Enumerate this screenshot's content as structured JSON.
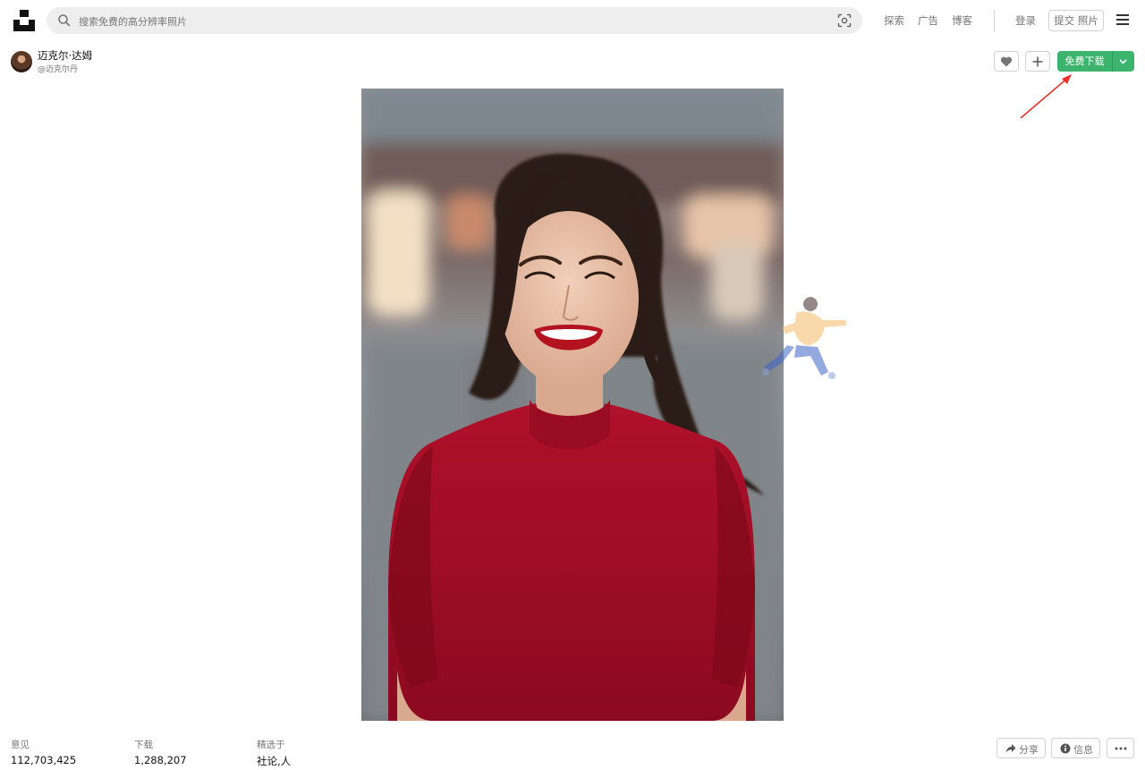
{
  "header": {
    "search_placeholder": "搜索免费的高分辨率照片",
    "nav": [
      "探索",
      "广告",
      "博客"
    ],
    "login": "登录",
    "submit_photo": "提交 照片"
  },
  "author": {
    "name": "迈克尔·达姆",
    "handle": "@迈克尔丹"
  },
  "actions": {
    "download_label": "免费下载"
  },
  "stats": {
    "views_label": "意见",
    "views_value": "112,703,425",
    "downloads_label": "下载",
    "downloads_value": "1,288,207",
    "featured_label": "精选于",
    "featured_value": "社论,人"
  },
  "footer_actions": {
    "share": "分享",
    "info": "信息"
  },
  "colors": {
    "accent_green": "#3cb46e",
    "annotation_arrow": "#e8312b"
  }
}
